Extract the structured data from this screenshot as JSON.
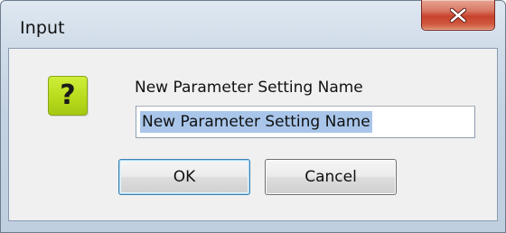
{
  "window": {
    "title": "Input",
    "close_icon": "close-x-icon"
  },
  "dialog": {
    "icon": "question-icon",
    "icon_glyph": "?",
    "icon_color": "#b8dc1c",
    "prompt": "New Parameter Setting Name",
    "input_value": "New Parameter Setting Name",
    "input_selected": true
  },
  "buttons": {
    "ok_label": "OK",
    "cancel_label": "Cancel"
  }
}
